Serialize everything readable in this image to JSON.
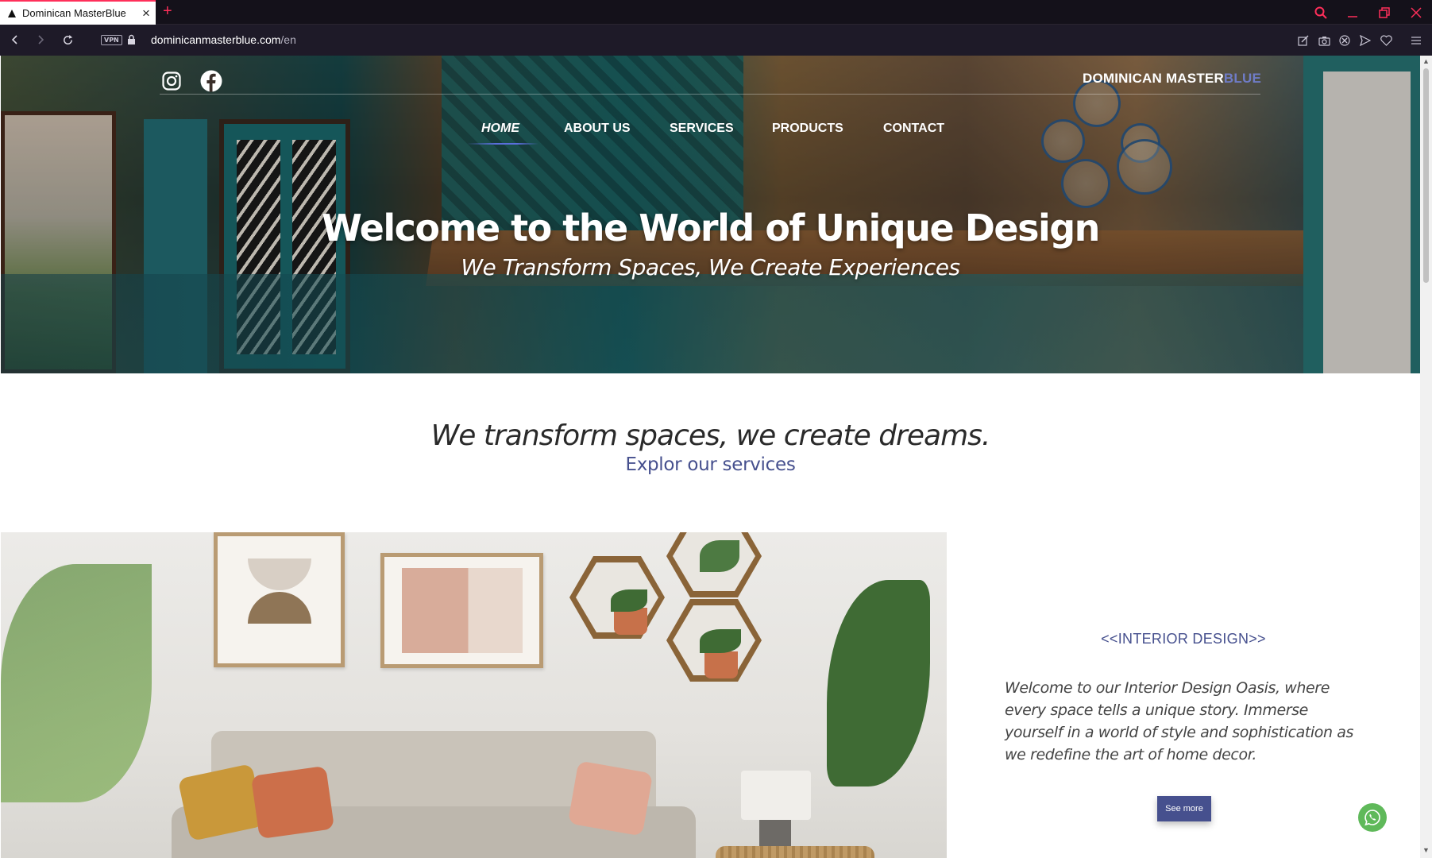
{
  "browser": {
    "tab_title": "Dominican MasterBlue",
    "url_domain": "dominicanmasterblue.com",
    "url_path": "/en",
    "vpn_label": "VPN",
    "accent_color": "#ff2f5a"
  },
  "header": {
    "brand_main": "DOMINICAN MASTER",
    "brand_blue": "BLUE",
    "social": [
      "instagram-icon",
      "facebook-icon"
    ]
  },
  "nav": {
    "items": [
      {
        "label": "HOME",
        "active": true
      },
      {
        "label": "ABOUT US",
        "active": false
      },
      {
        "label": "SERVICES",
        "active": false
      },
      {
        "label": "PRODUCTS",
        "active": false
      },
      {
        "label": "CONTACT",
        "active": false
      }
    ]
  },
  "hero": {
    "title": "Welcome to the World of Unique Design",
    "subtitle": "We Transform Spaces, We Create Experiences"
  },
  "intro": {
    "tagline": "We transform spaces, we create dreams.",
    "explore_link": "Explor our services"
  },
  "interior": {
    "title": "<<INTERIOR DESIGN>>",
    "description": "Welcome to our Interior Design Oasis, where every space tells a unique story. Immerse yourself in a world of style and sophistication as we redefine the art of home decor.",
    "button": "See more"
  },
  "colors": {
    "brand_blue": "#46508e",
    "nav_underline": "#5a6edc",
    "whatsapp_green": "#5fb95a"
  }
}
